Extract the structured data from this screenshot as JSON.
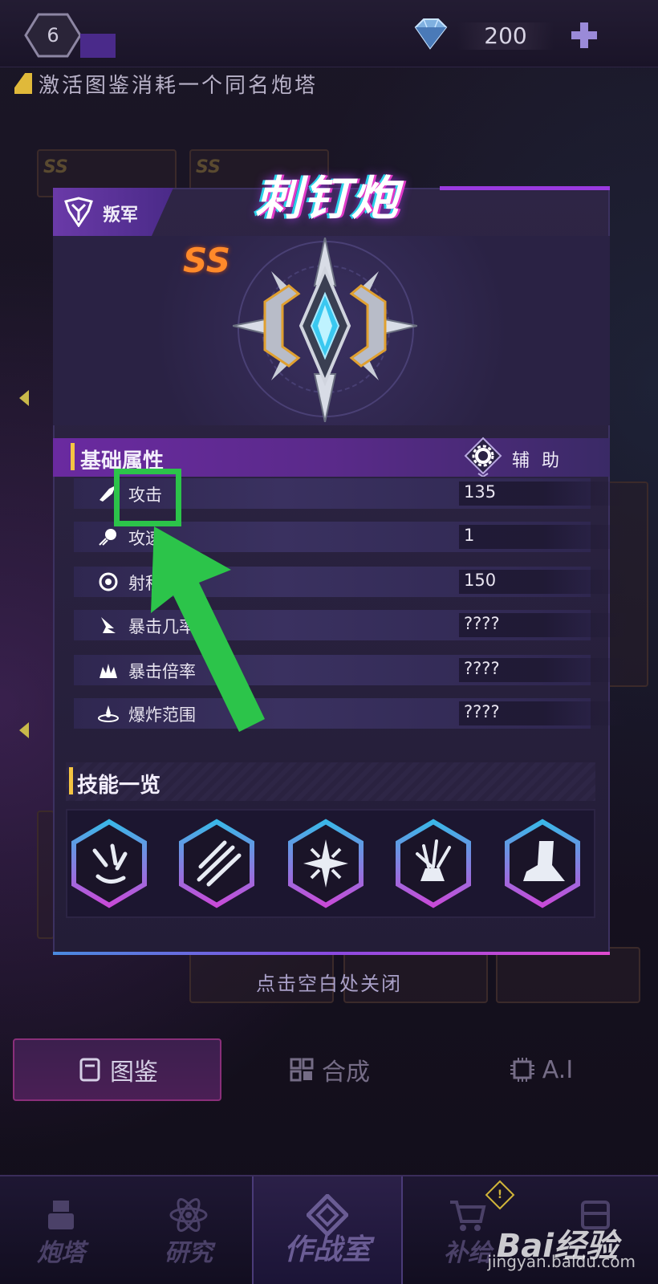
{
  "top_bar": {
    "level": "6",
    "gems": "200"
  },
  "notice": "激活图鉴消耗一个同名炮塔",
  "modal": {
    "faction": "叛军",
    "title": "刺钉炮",
    "grade": "SS",
    "section_basic": "基础属性",
    "role": "辅 助",
    "stats": [
      {
        "name": "攻击",
        "value": "135",
        "icon": "attack-icon"
      },
      {
        "name": "攻速",
        "value": "1",
        "icon": "attack-speed-icon"
      },
      {
        "name": "射程",
        "value": "150",
        "icon": "range-icon"
      },
      {
        "name": "暴击几率",
        "value": "????",
        "icon": "crit-rate-icon"
      },
      {
        "name": "暴击倍率",
        "value": "????",
        "icon": "crit-multiplier-icon"
      },
      {
        "name": "爆炸范围",
        "value": "????",
        "icon": "explosion-range-icon"
      }
    ],
    "section_skills": "技能一览",
    "skills": [
      "claw-skill-icon",
      "spikes-skill-icon",
      "starburst-skill-icon",
      "bundle-skill-icon",
      "spike-boot-skill-icon"
    ]
  },
  "close_hint": "点击空白处关闭",
  "tabs": [
    {
      "label": "图鉴",
      "icon": "codex-icon",
      "active": true
    },
    {
      "label": "合成",
      "icon": "synthesis-icon",
      "active": false
    },
    {
      "label": "A.I",
      "icon": "ai-chip-icon",
      "active": false
    }
  ],
  "bottom_nav": [
    {
      "label": "炮塔",
      "icon": "turret-icon"
    },
    {
      "label": "研究",
      "icon": "atom-icon"
    },
    {
      "label": "作战室",
      "icon": "war-room-icon",
      "active": true
    },
    {
      "label": "补给",
      "icon": "cart-icon",
      "badge": "!"
    },
    {
      "label": "",
      "icon": "supply-box-icon"
    }
  ],
  "watermark": {
    "logo": "Bai经验",
    "url": "jingyan.baidu.com"
  },
  "colors": {
    "highlight": "#2cc44a",
    "accent_purple": "#6a2aa0",
    "grade_orange": "#ff8a2a",
    "section_bar": "#f5c542"
  }
}
